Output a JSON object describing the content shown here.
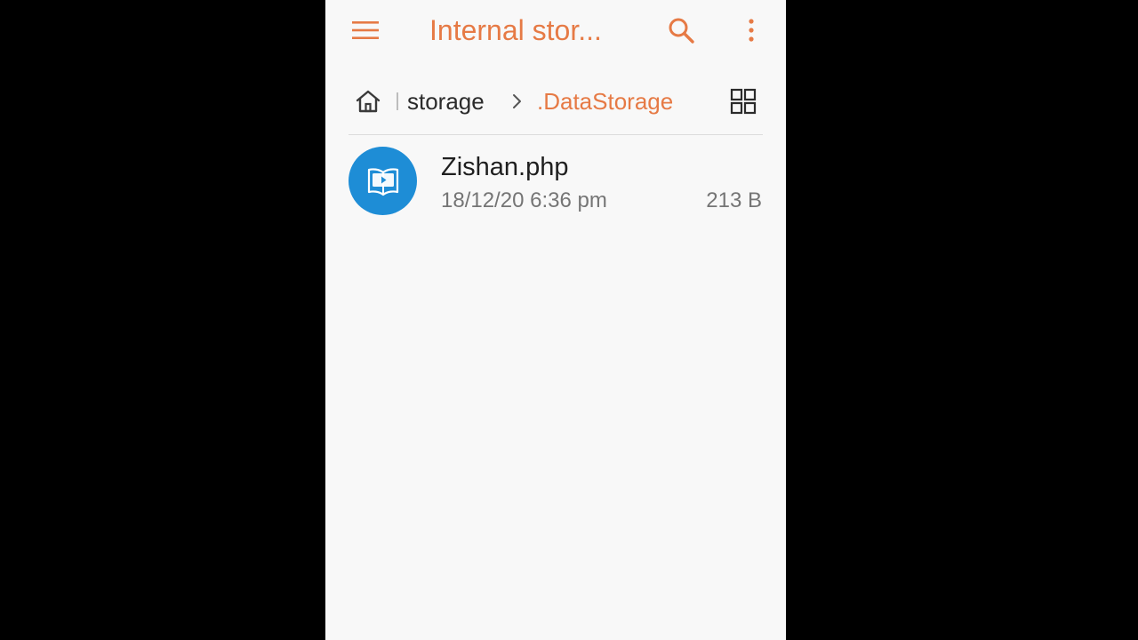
{
  "appbar": {
    "title": "Internal stor...",
    "menu_icon": "hamburger-menu-icon",
    "search_icon": "search-icon",
    "more_icon": "more-vert-icon"
  },
  "breadcrumb": {
    "home_icon": "home-icon",
    "items": [
      {
        "label": "storage"
      },
      {
        "label": ".DataStorage"
      }
    ],
    "view_icon": "grid-view-icon"
  },
  "files": [
    {
      "name": "Zishan.php",
      "date": "18/12/20 6:36 pm",
      "size": "213 B",
      "icon": "book-file-icon"
    }
  ],
  "colors": {
    "accent": "#e67a45",
    "file_icon_bg": "#1e8dd6",
    "background": "#f8f8f8"
  }
}
